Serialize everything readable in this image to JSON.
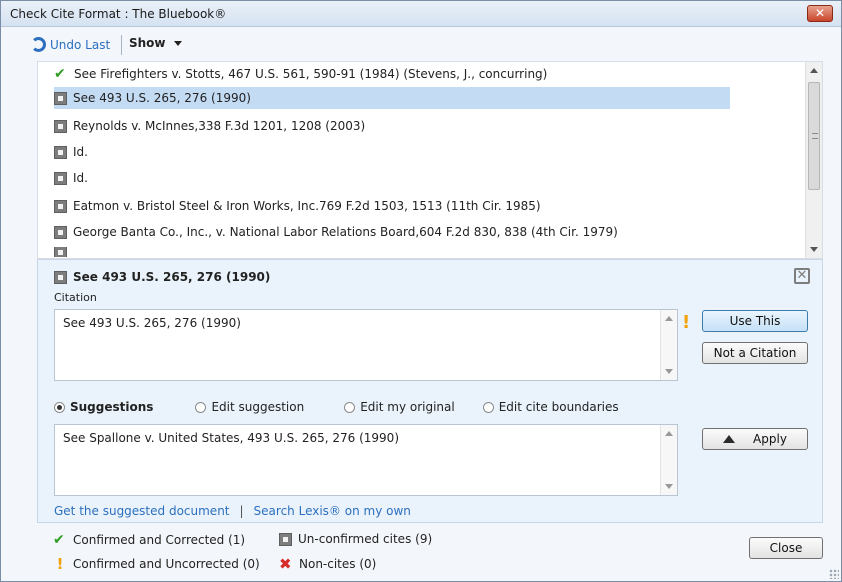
{
  "window": {
    "title": "Check Cite Format : The Bluebook®"
  },
  "toolbar": {
    "undo_label": "Undo Last",
    "show_label": "Show"
  },
  "cite_list": [
    {
      "status": "confirmed",
      "text": "See Firefighters v. Stotts, 467 U.S. 561, 590-91 (1984) (Stevens, J., concurring)"
    },
    {
      "status": "unconfirmed",
      "text": "See 493 U.S. 265, 276  (1990)",
      "selected": true
    },
    {
      "status": "unconfirmed",
      "text": "Reynolds v. McInnes,338 F.3d 1201, 1208  (2003)"
    },
    {
      "status": "unconfirmed",
      "text": "Id."
    },
    {
      "status": "unconfirmed",
      "text": "Id."
    },
    {
      "status": "unconfirmed",
      "text": "Eatmon v. Bristol Steel & Iron Works, Inc.769 F.2d 1503, 1513  (11th Cir. 1985)"
    },
    {
      "status": "unconfirmed",
      "text": "George Banta Co., Inc., v. National Labor Relations Board,604 F.2d 830, 838  (4th Cir. 1979)"
    }
  ],
  "detail": {
    "heading": "See 493 U.S. 265, 276  (1990)",
    "citation_label": "Citation",
    "citation_value": "See 493 U.S. 265, 276  (1990)",
    "use_this_label": "Use This",
    "not_citation_label": "Not a Citation",
    "radios": [
      {
        "label": "Suggestions",
        "checked": true
      },
      {
        "label": "Edit suggestion",
        "checked": false
      },
      {
        "label": "Edit my original",
        "checked": false
      },
      {
        "label": "Edit cite boundaries",
        "checked": false
      }
    ],
    "suggestion_value": "See Spallone v. United States, 493 U.S. 265, 276 (1990)",
    "apply_label": "Apply",
    "link_suggested": "Get the suggested document",
    "link_sep": "|",
    "link_search": "Search Lexis® on my own"
  },
  "legend": {
    "confirmed_corrected": "Confirmed and Corrected (1)",
    "confirmed_uncorrected": "Confirmed and Uncorrected (0)",
    "unconfirmed": "Un-confirmed cites (9)",
    "noncites": "Non-cites (0)"
  },
  "footer": {
    "close_label": "Close"
  },
  "colors": {
    "confirmed": "#2f9c22",
    "warning": "#f2a20c",
    "noncite": "#d62b2b",
    "link": "#2c6fbf",
    "selection": "#c4dbf4"
  }
}
